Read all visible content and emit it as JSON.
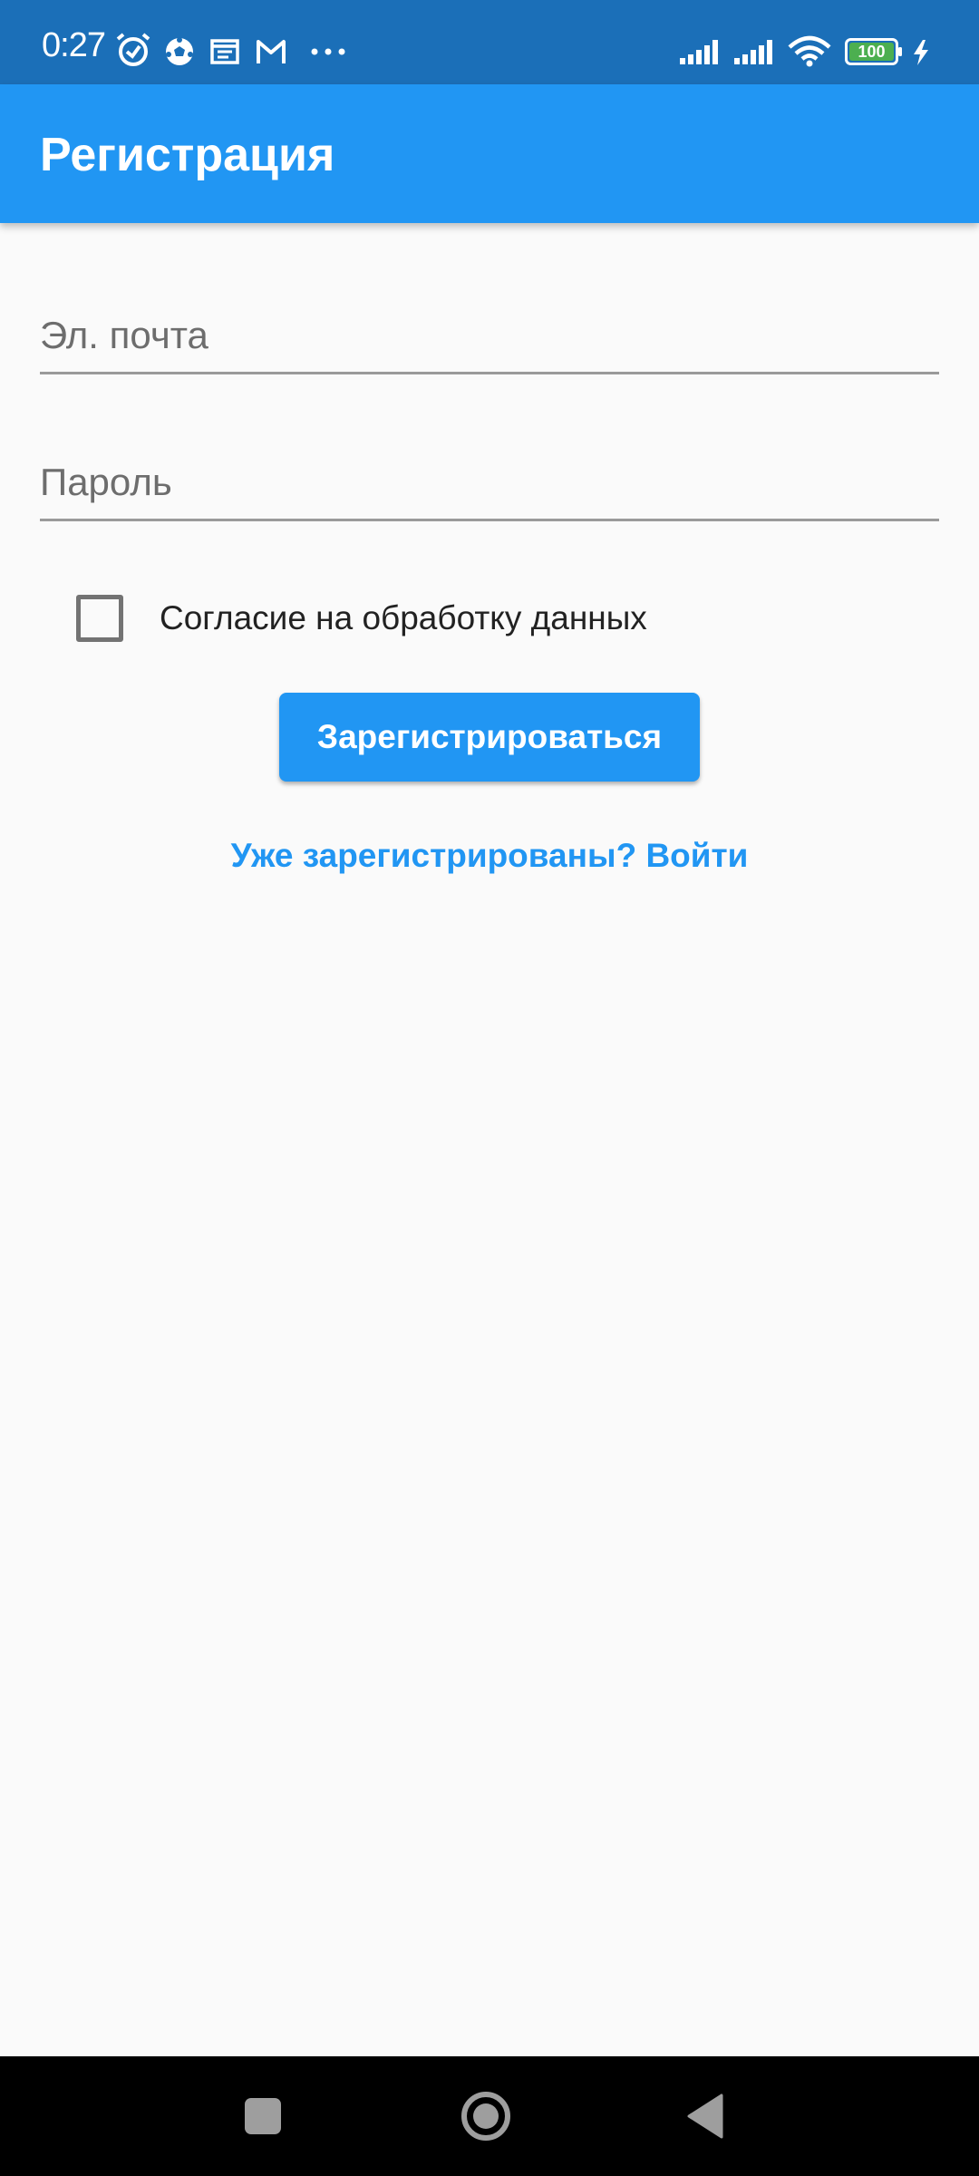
{
  "status_bar": {
    "time": "0:27",
    "battery": "100",
    "icons": [
      "alarm-icon",
      "soccer-ball-icon",
      "calendar-icon",
      "gmail-icon",
      "more-dots-icon",
      "signal-icon",
      "signal-icon",
      "wifi-icon",
      "battery-icon",
      "charging-icon"
    ]
  },
  "app_bar": {
    "title": "Регистрация"
  },
  "form": {
    "email_placeholder": "Эл. почта",
    "password_placeholder": "Пароль",
    "consent_label": "Согласие на обработку данных",
    "consent_checked": false,
    "register_label": "Зарегистрироваться",
    "login_link": "Уже зарегистрированы? Войти"
  },
  "nav_bar": {
    "buttons": [
      "recents-square-icon",
      "home-circle-icon",
      "back-triangle-icon"
    ]
  },
  "colors": {
    "status_bar": "#1b6fb8",
    "primary": "#2196f3",
    "background": "#fafafa",
    "battery_fill": "#4caf50"
  }
}
